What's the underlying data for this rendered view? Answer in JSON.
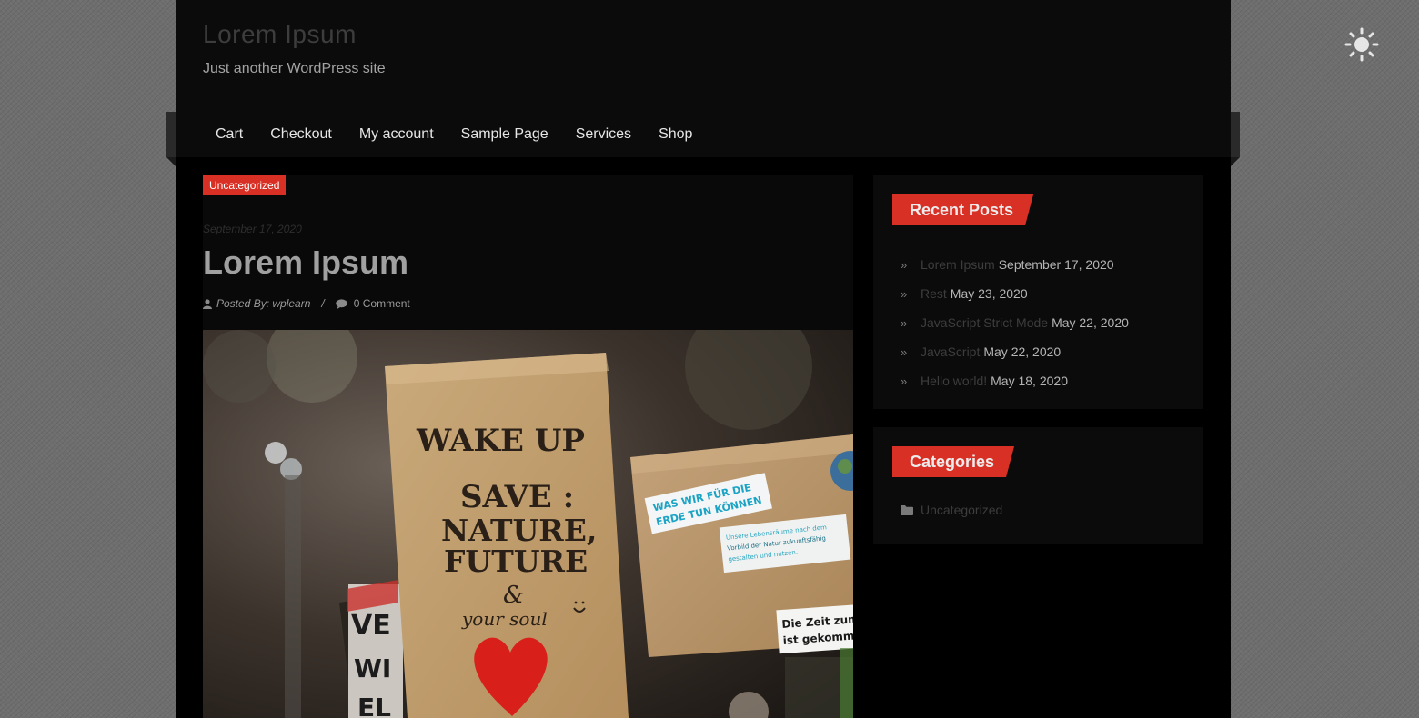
{
  "header": {
    "site_title": "Lorem Ipsum",
    "tagline": "Just another WordPress site"
  },
  "nav": {
    "items": [
      {
        "label": "Cart"
      },
      {
        "label": "Checkout"
      },
      {
        "label": "My account"
      },
      {
        "label": "Sample Page"
      },
      {
        "label": "Services"
      },
      {
        "label": "Shop"
      }
    ]
  },
  "theme_toggle": {
    "icon": "sun-icon"
  },
  "post": {
    "category": "Uncategorized",
    "date": "September 17, 2020",
    "title": "Lorem Ipsum",
    "author": "Posted By: wplearn",
    "separator": "/",
    "comments": "0 Comment",
    "image": {
      "sign_line1": "WAKE UP",
      "sign_line2": "SAVE :",
      "sign_line3": "NATURE,",
      "sign_line4": "FUTURE",
      "sign_line5": "&",
      "sign_line6": "your soul",
      "sticker1_line1": "WAS WIR FÜR DIE",
      "sticker1_line2": "ERDE TUN KÖNNEN",
      "sticker2_line1": "Unsere Lebensräume nach dem",
      "sticker2_line2": "Vorbild der Natur zukunftsfähig",
      "sticker2_line3": "gestalten und nutzen.",
      "sticker3_line1": "Die Zeit zum",
      "sticker3_line2": "ist gekomme"
    }
  },
  "sidebar": {
    "recent_posts": {
      "title": "Recent Posts",
      "items": [
        {
          "title": "Lorem Ipsum",
          "date": "September 17, 2020"
        },
        {
          "title": "Rest",
          "date": "May 23, 2020"
        },
        {
          "title": "JavaScript Strict Mode",
          "date": "May 22, 2020"
        },
        {
          "title": "JavaScript",
          "date": "May 22, 2020"
        },
        {
          "title": "Hello world!",
          "date": "May 18, 2020"
        }
      ]
    },
    "categories": {
      "title": "Categories",
      "items": [
        {
          "label": "Uncategorized"
        }
      ]
    }
  },
  "colors": {
    "accent": "#d93025",
    "page_bg": "#000000",
    "panel_bg": "#0b0b0b",
    "outer_bg": "#6e6e6e"
  }
}
